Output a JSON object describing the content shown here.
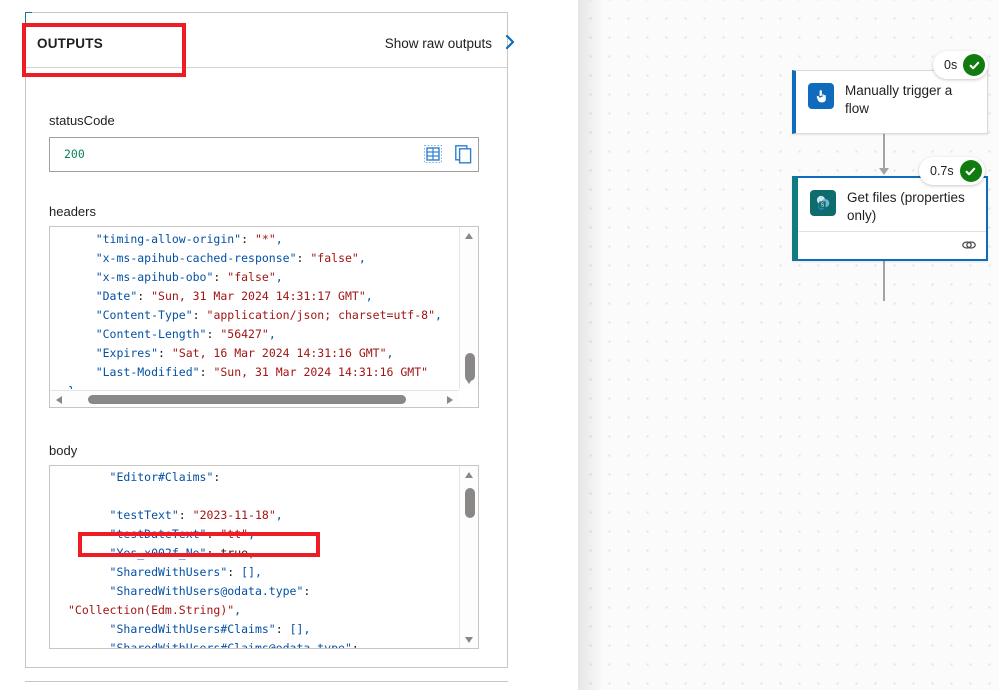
{
  "panel": {
    "header": {
      "title": "OUTPUTS",
      "show_raw_label": "Show raw outputs",
      "chevron_icon": "chevron-right-icon"
    },
    "fields": {
      "statuscode_label": "statusCode",
      "statuscode_value": "200",
      "statuscode_table_icon": "table-icon",
      "statuscode_copy_icon": "copy-icon",
      "headers_label": "headers",
      "body_label": "body"
    },
    "headers_code": "    \"timing-allow-origin\": \"*\",\n    \"x-ms-apihub-cached-response\": \"false\",\n    \"x-ms-apihub-obo\": \"false\",\n    \"Date\": \"Sun, 31 Mar 2024 14:31:17 GMT\",\n    \"Content-Type\": \"application/json; charset=utf-8\",\n    \"Content-Length\": \"56427\",\n    \"Expires\": \"Sat, 16 Mar 2024 14:31:16 GMT\",\n    \"Last-Modified\": \"Sun, 31 Mar 2024 14:31:16 GMT\"\n}",
    "body_code": "      \"Editor#Claims\":\n\n      \"testText\": \"2023-11-18\",\n      \"testDateText\": \"tt\",\n      \"Yes_x002f_No\": true,\n      \"SharedWithUsers\": [],\n      \"SharedWithUsers@odata.type\":\n\"Collection(Edm.String)\",\n      \"SharedWithUsers#Claims\": [],\n      \"SharedWithUsers#Claims@odata.type\":"
  },
  "annotations": {
    "outputs_highlight": "red-rectangle-outputs-header",
    "yesno_highlight": "red-rectangle-yes-no-line"
  },
  "canvas": {
    "nodes": [
      {
        "id": "manually-trigger-a-flow",
        "title": "Manually trigger a flow",
        "icon": "hand-pointer-icon",
        "duration": "0s",
        "status_icon": "check-circle-icon",
        "selected": false,
        "accent_color": "#0f6cbd"
      },
      {
        "id": "get-files-properties-only",
        "title": "Get files (properties only)",
        "icon": "sharepoint-icon",
        "duration": "0.7s",
        "status_icon": "check-circle-icon",
        "selected": true,
        "accent_color": "#0e6c6c",
        "footer_icon": "link-chain-icon"
      }
    ]
  }
}
